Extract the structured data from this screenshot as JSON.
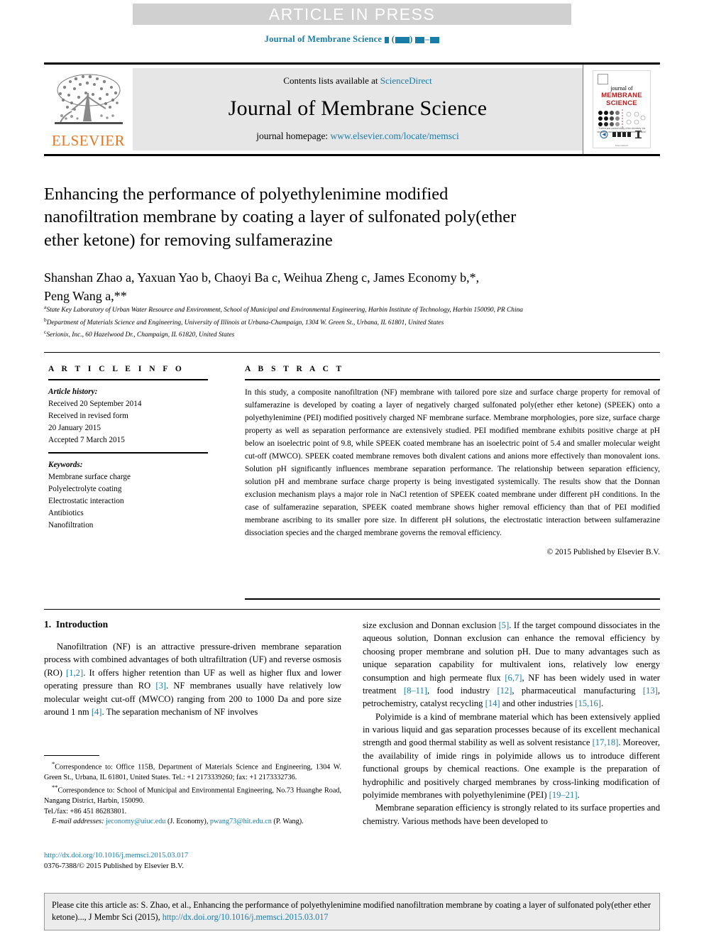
{
  "banner": {
    "text": "ARTICLE IN PRESS"
  },
  "running_head": {
    "journal": "Journal of Membrane Science",
    "volume_placeholder": "▪ (▪▪▪▪) ▪▪▪–▪▪▪"
  },
  "masthead": {
    "publisher": "ELSEVIER",
    "contents_prefix": "Contents lists available at",
    "contents_link": "ScienceDirect",
    "journal_title": "Journal of Membrane Science",
    "homepage_prefix": "journal homepage:",
    "homepage_link": "www.elsevier.com/locate/memsci",
    "cover": {
      "line1": "journal of",
      "line2": "MEMBRANE",
      "line3": "SCIENCE",
      "caption": "\"Further and content study of the chemistry, the separation and the industrial membrane filtration\"",
      "footer": "ScienceDirect"
    }
  },
  "article": {
    "title": "Enhancing the performance of polyethylenimine modified nanofiltration membrane by coating a layer of sulfonated poly(ether ether ketone) for removing sulfamerazine",
    "authors_line1": "Shanshan Zhao a, Yaxuan Yao b, Chaoyi Ba c, Weihua Zheng c, James Economy b,*,",
    "authors_line2": "Peng Wang a,**",
    "affiliations": [
      {
        "marker": "a",
        "text": "State Key Laboratory of Urban Water Resource and Environment, School of Municipal and Environmental Engineering, Harbin Institute of Technology, Harbin 150090, PR China"
      },
      {
        "marker": "b",
        "text": "Department of Materials Science and Engineering, University of Illinois at Urbana-Champaign, 1304 W. Green St., Urbana, IL 61801, United States"
      },
      {
        "marker": "c",
        "text": "Serionix, Inc., 60 Hazelwood Dr., Champaign, IL 61820, United States"
      }
    ]
  },
  "article_info": {
    "heading": "A R T I C L E   I N F O",
    "history_label": "Article history:",
    "history": [
      "Received 20 September 2014",
      "Received in revised form",
      "20 January 2015",
      "Accepted 7 March 2015"
    ],
    "keywords_label": "Keywords:",
    "keywords": [
      "Membrane surface charge",
      "Polyelectrolyte coating",
      "Electrostatic interaction",
      "Antibiotics",
      "Nanofiltration"
    ]
  },
  "abstract": {
    "heading": "A B S T R A C T",
    "text": "In this study, a composite nanofiltration (NF) membrane with tailored pore size and surface charge property for removal of sulfamerazine is developed by coating a layer of negatively charged sulfonated poly(ether ether ketone) (SPEEK) onto a polyethylenimine (PEI) modified positively charged NF membrane surface. Membrane morphologies, pore size, surface charge property as well as separation performance are extensively studied. PEI modified membrane exhibits positive charge at pH below an isoelectric point of 9.8, while SPEEK coated membrane has an isoelectric point of 5.4 and smaller molecular weight cut-off (MWCO). SPEEK coated membrane removes both divalent cations and anions more effectively than monovalent ions. Solution pH significantly influences membrane separation performance. The relationship between separation efficiency, solution pH and membrane surface charge property is being investigated systemically. The results show that the Donnan exclusion mechanism plays a major role in NaCl retention of SPEEK coated membrane under different pH conditions. In the case of sulfamerazine separation, SPEEK coated membrane shows higher removal efficiency than that of PEI modified membrane ascribing to its smaller pore size. In different pH solutions, the electrostatic interaction between sulfamerazine dissociation species and the charged membrane governs the removal efficiency.",
    "copyright": "© 2015 Published by Elsevier B.V."
  },
  "body": {
    "section_number": "1.",
    "section_title": "Introduction",
    "left_paragraph_1_a": "Nanofiltration (NF) is an attractive pressure-driven membrane separation process with combined advantages of both ultrafiltration (UF) and reverse osmosis (RO) ",
    "ref_1_2": "[1,2]",
    "left_paragraph_1_b": ". It offers higher retention than UF as well as higher flux and lower operating pressure than RO ",
    "ref_3": "[3]",
    "left_paragraph_1_c": ". NF membranes usually have relatively low molecular weight cut-off (MWCO) ranging from 200 to 1000 Da and pore size around 1 nm ",
    "ref_4": "[4]",
    "left_paragraph_1_d": ". The separation mechanism of NF involves",
    "right_paragraph_1_a": "size exclusion and Donnan exclusion ",
    "ref_5": "[5]",
    "right_paragraph_1_b": ". If the target compound dissociates in the aqueous solution, Donnan exclusion can enhance the removal efficiency by choosing proper membrane and solution pH. Due to many advantages such as unique separation capability for multivalent ions, relatively low energy consumption and high permeate flux ",
    "ref_6_7": "[6,7]",
    "right_paragraph_1_c": ", NF has been widely used in water treatment ",
    "ref_8_11": "[8–11]",
    "right_paragraph_1_d": ", food industry ",
    "ref_12": "[12]",
    "right_paragraph_1_e": ", pharmaceutical manufacturing ",
    "ref_13": "[13]",
    "right_paragraph_1_f": ", petrochemistry, catalyst recycling ",
    "ref_14": "[14]",
    "right_paragraph_1_g": " and other industries ",
    "ref_15_16": "[15,16]",
    "right_paragraph_1_h": ".",
    "right_paragraph_2_a": "Polyimide is a kind of membrane material which has been extensively applied in various liquid and gas separation processes because of its excellent mechanical strength and good thermal stability as well as solvent resistance ",
    "ref_17_18": "[17,18]",
    "right_paragraph_2_b": ". Moreover, the availability of imide rings in polyimide allows us to introduce different functional groups by chemical reactions. One example is the preparation of hydrophilic and positively charged membranes by cross-linking modification of polyimide membranes with polyethylenimine (PEI) ",
    "ref_19_21": "[19–21]",
    "right_paragraph_2_c": ".",
    "right_paragraph_3": "Membrane separation efficiency is strongly related to its surface properties and chemistry. Various methods have been developed to"
  },
  "footnotes": {
    "note1_marker": "*",
    "note1": "Correspondence to: Office 115B, Department of Materials Science and Engineering, 1304 W. Green St., Urbana, IL 61801, United States. Tel.: +1 2173339260; fax: +1 2173332736.",
    "note2_marker": "**",
    "note2": "Correspondence to: School of Municipal and Environmental Engineering, No.73 Huanghe Road, Nangang District, Harbin, 150090.",
    "note2_tel": "Tel./fax: +86 451 86283801.",
    "email_label": "E-mail addresses:",
    "email1": "jeconomy@uiuc.edu",
    "email1_name": "(J. Economy),",
    "email2": "pwang73@hit.edu.cn",
    "email2_name": "(P. Wang)."
  },
  "doi_block": {
    "doi_url": "http://dx.doi.org/10.1016/j.memsci.2015.03.017",
    "issn_line": "0376-7388/© 2015 Published by Elsevier B.V."
  },
  "cite_box": {
    "text_before_link": "Please cite this article as: S. Zhao, et al., Enhancing the performance of polyethylenimine modified nanofiltration membrane by coating a layer of sulfonated poly(ether ether ketone)..., J Membr Sci (2015), ",
    "link": "http://dx.doi.org/10.1016/j.memsci.2015.03.017"
  },
  "colors": {
    "link": "#1a7da8",
    "banner_bg": "#d0d0d0",
    "masthead_bg": "#e6e6e6",
    "elsevier_orange": "#e87722",
    "cover_red": "#b22222"
  }
}
